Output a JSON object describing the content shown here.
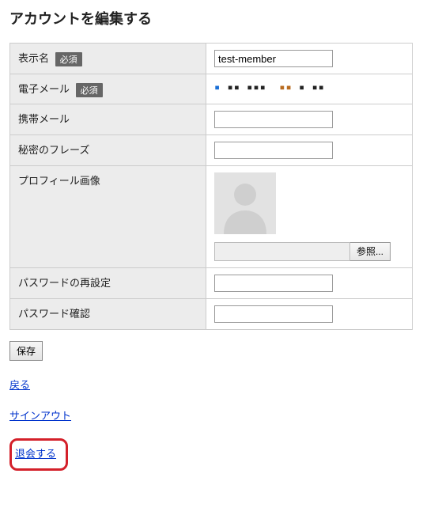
{
  "page": {
    "title": "アカウントを編集する"
  },
  "labels": {
    "display_name": "表示名",
    "email": "電子メール",
    "mobile_email": "携帯メール",
    "secret_phrase": "秘密のフレーズ",
    "profile_image": "プロフィール画像",
    "password_reset": "パスワードの再設定",
    "password_confirm": "パスワード確認",
    "required_badge": "必須"
  },
  "values": {
    "display_name": "test-member",
    "email_masked": "▪ ▪▪ ▪▪▪  ▪▪ ▪ ▪▪",
    "mobile_email": "",
    "secret_phrase": "",
    "password_reset": "",
    "password_confirm": ""
  },
  "buttons": {
    "browse": "参照...",
    "save": "保存"
  },
  "links": {
    "back": "戻る",
    "signout": "サインアウト",
    "withdraw": "退会する"
  }
}
